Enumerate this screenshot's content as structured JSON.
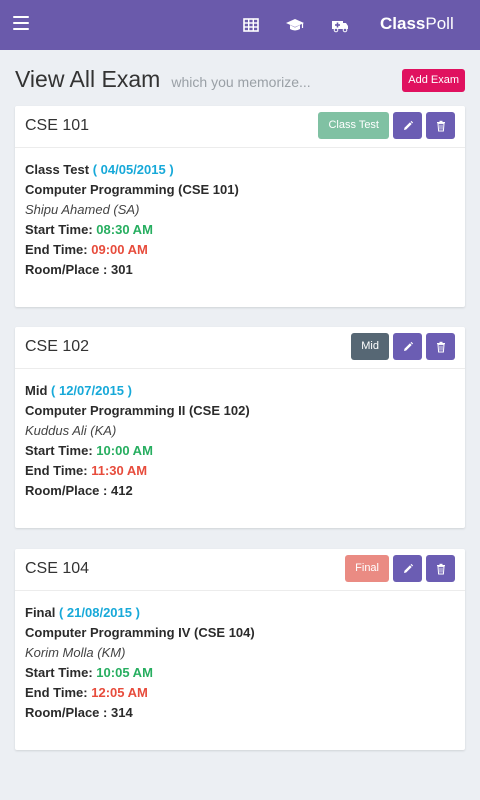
{
  "app": {
    "brand_bold": "Class",
    "brand_rest": "Poll"
  },
  "header": {
    "title": "View All Exam",
    "subtitle": "which you memorize...",
    "add_button": "Add Exam"
  },
  "exams": [
    {
      "code": "CSE 101",
      "type_label": "Class Test",
      "type_color": "#80c1a3",
      "exam_type": "Class Test",
      "date": "04/05/2015",
      "course": "Computer Programming (CSE 101)",
      "teacher": "Shipu Ahamed (SA)",
      "start_label": "Start Time:",
      "start_time": "08:30 AM",
      "end_label": "End Time:",
      "end_time": "09:00 AM",
      "room_label": "Room/Place :",
      "room": "301"
    },
    {
      "code": "CSE 102",
      "type_label": "Mid",
      "type_color": "#566774",
      "exam_type": "Mid",
      "date": "12/07/2015",
      "course": "Computer Programming II (CSE 102)",
      "teacher": "Kuddus Ali (KA)",
      "start_label": "Start Time:",
      "start_time": "10:00 AM",
      "end_label": "End Time:",
      "end_time": "11:30 AM",
      "room_label": "Room/Place :",
      "room": "412"
    },
    {
      "code": "CSE 104",
      "type_label": "Final",
      "type_color": "#ea8b83",
      "exam_type": "Final",
      "date": "21/08/2015",
      "course": "Computer Programming IV (CSE 104)",
      "teacher": "Korim Molla (KM)",
      "start_label": "Start Time:",
      "start_time": "10:05 AM",
      "end_label": "End Time:",
      "end_time": "12:05 AM",
      "room_label": "Room/Place :",
      "room": "314"
    }
  ],
  "icons": {
    "menu": "hamburger-menu-icon",
    "table": "table-grid-icon",
    "graduation": "graduation-cap-icon",
    "ambulance": "ambulance-icon",
    "edit": "pencil-icon",
    "delete": "trash-icon"
  },
  "colors": {
    "topbar": "#6a5aab",
    "accent_button": "#e0115f",
    "icon_button": "#6b5db3",
    "date": "#17a9d9",
    "start": "#27ae60",
    "end": "#e74c3c"
  }
}
